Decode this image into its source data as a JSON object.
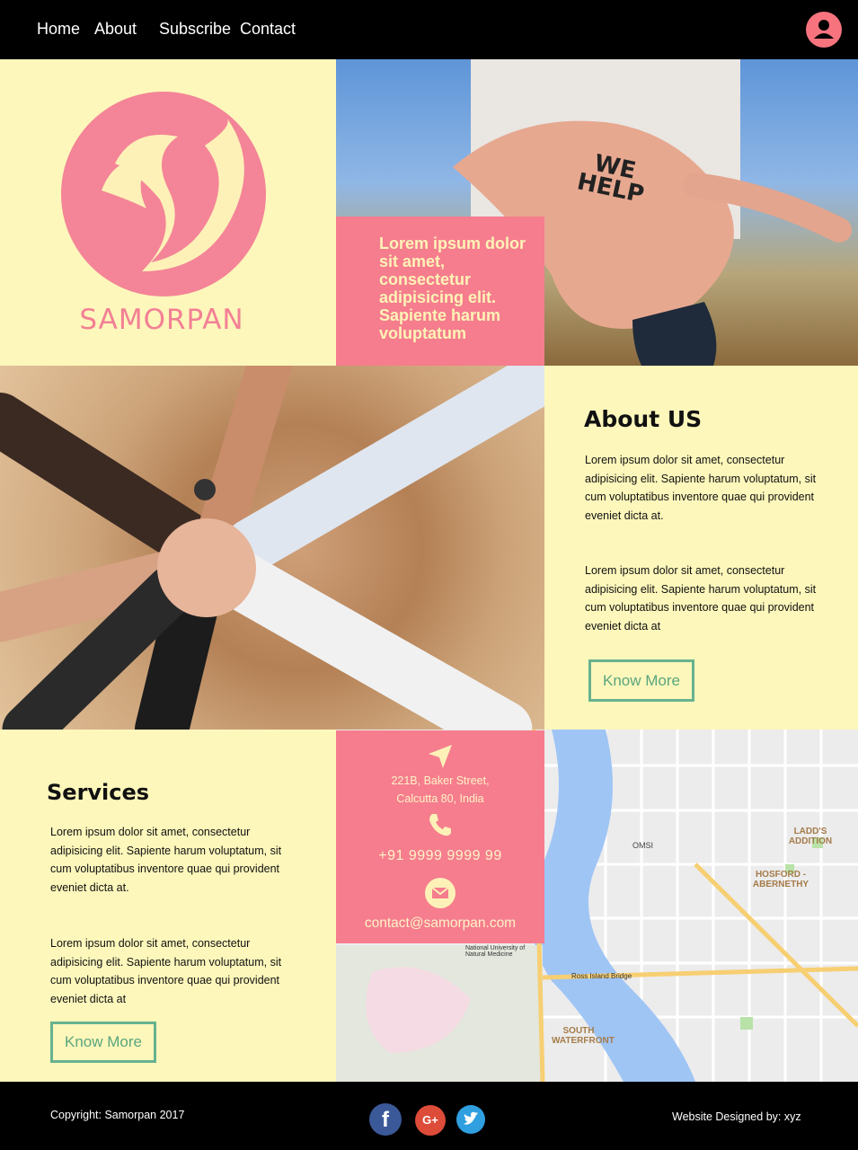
{
  "nav": {
    "home": "Home",
    "about": "About",
    "subscribe": "Subscribe",
    "contact": "Contact"
  },
  "brand": {
    "name": "SAMORPAN"
  },
  "hero": {
    "image_text": "WE HELP",
    "tagline": "Lorem ipsum dolor sit amet, consectetur adipisicing elit. Sapiente harum voluptatum"
  },
  "about": {
    "title": "About US",
    "p1": "Lorem ipsum dolor sit amet, consectetur adipisicing elit. Sapiente harum voluptatum, sit cum voluptatibus inventore quae qui provident eveniet dicta at.",
    "p2": "Lorem ipsum dolor sit amet, consectetur adipisicing elit. Sapiente harum voluptatum, sit cum voluptatibus inventore quae qui provident eveniet dicta at",
    "button": "Know More"
  },
  "services": {
    "title": "Services",
    "p1": "Lorem ipsum dolor sit amet, consectetur adipisicing elit. Sapiente harum voluptatum, sit cum voluptatibus inventore quae qui provident eveniet dicta at.",
    "p2": "Lorem ipsum dolor sit amet, consectetur adipisicing elit. Sapiente harum voluptatum, sit cum voluptatibus inventore quae qui provident eveniet dicta at",
    "button": "Know More"
  },
  "contact": {
    "address_line1": "221B, Baker Street,",
    "address_line2": "Calcutta 80, India",
    "phone": "+91 9999 9999 99",
    "email": "contact@samorpan.com"
  },
  "map": {
    "labels": [
      "LADD'S ADDITION",
      "HOSFORD - ABERNETHY",
      "SOUTH WATERFRONT",
      "OMSI",
      "Ross Island Bridge",
      "National University of Natural Medicine"
    ]
  },
  "footer": {
    "copyright": "Copyright: Samorpan 2017",
    "designer": "Website Designed by: xyz"
  },
  "social": {
    "facebook": "f",
    "google": "G+"
  },
  "colors": {
    "cream": "#fdf7bb",
    "pink": "#f57d8e",
    "green": "#67b28f",
    "black": "#000000"
  }
}
